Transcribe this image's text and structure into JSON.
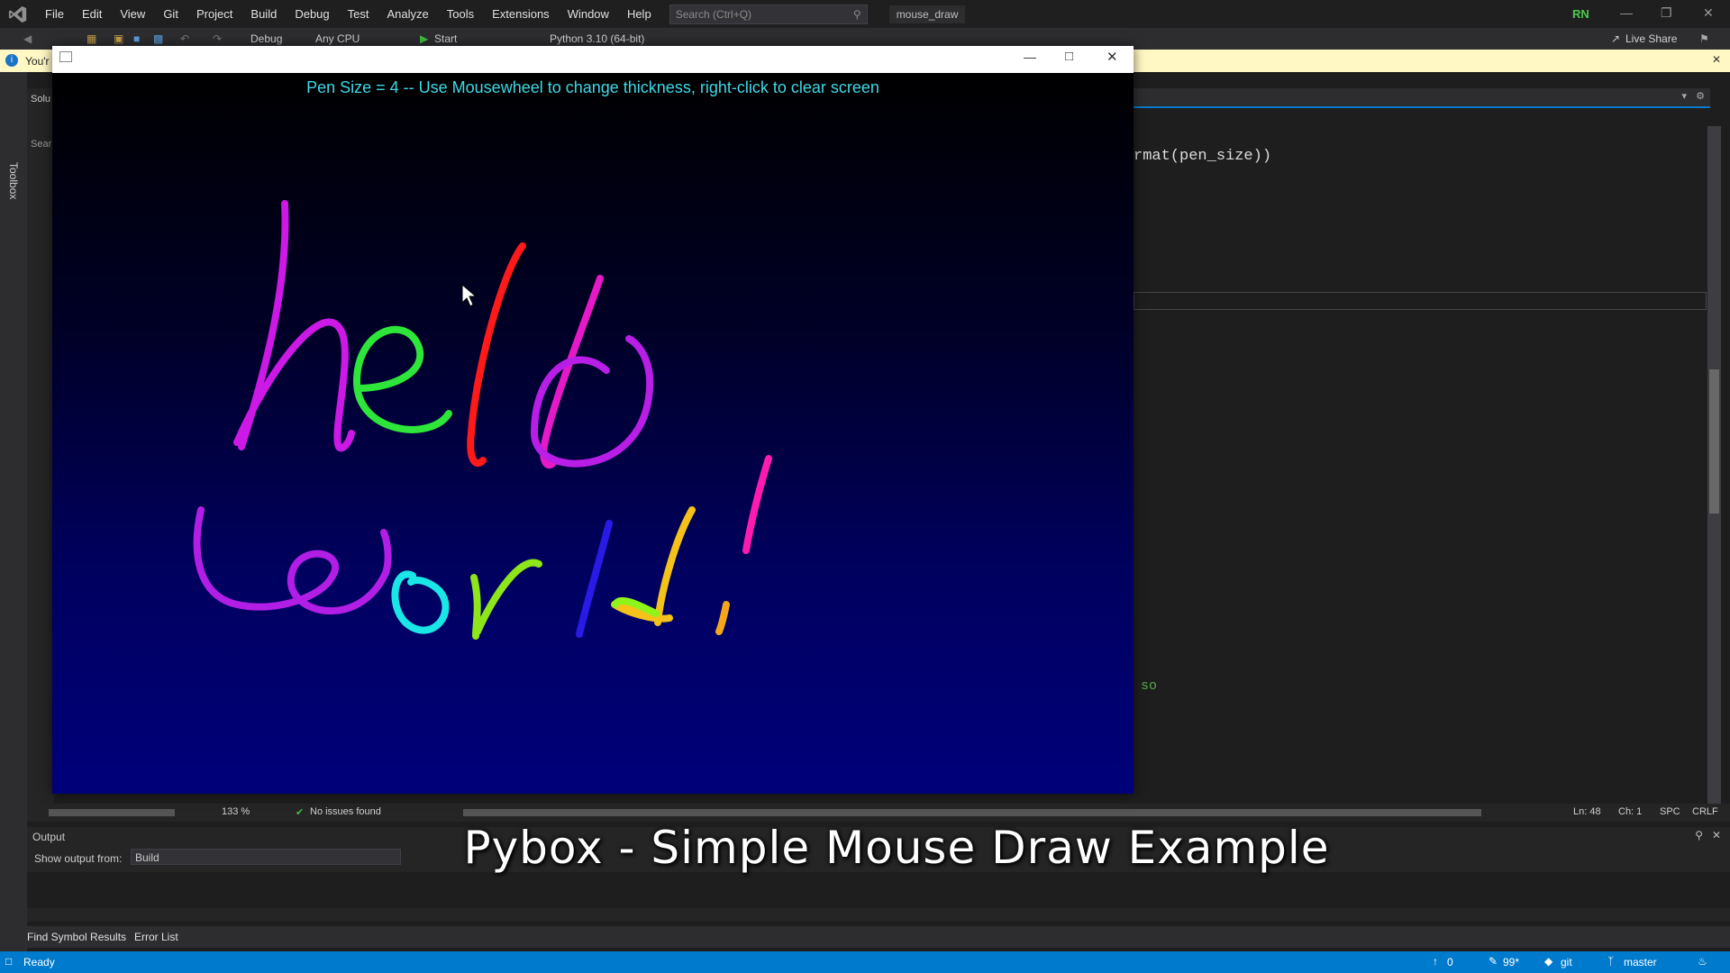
{
  "menubar": {
    "items": [
      "File",
      "Edit",
      "View",
      "Git",
      "Project",
      "Build",
      "Debug",
      "Test",
      "Analyze",
      "Tools",
      "Extensions",
      "Window",
      "Help"
    ],
    "search_placeholder": "Search (Ctrl+Q)",
    "solution_name": "mouse_draw",
    "user_initials": "RN"
  },
  "toolbar": {
    "config": "Debug",
    "platform": "Any CPU",
    "start_label": "Start",
    "environment": "Python 3.10 (64-bit)",
    "live_share": "Live Share"
  },
  "infobar": {
    "text": "You'r"
  },
  "toolbox": {
    "label": "Toolbox"
  },
  "solution_panel": {
    "label": "Solu",
    "search": "Sear"
  },
  "editor": {
    "line1": "rmat(pen_size))",
    "fragment": "so",
    "zoom": "133 %",
    "issues": "No issues found",
    "ln": "Ln: 48",
    "ch": "Ch: 1",
    "spc": "SPC",
    "eol": "CRLF"
  },
  "output": {
    "title": "Output",
    "show_from_label": "Show output from:",
    "source": "Build"
  },
  "bottom_tabs": [
    "Find Symbol Results",
    "Error List"
  ],
  "statusbar": {
    "ready": "Ready",
    "up_count": "0",
    "pencil_count": "99*",
    "git": "git",
    "branch": "master"
  },
  "pygame": {
    "pen_text": "Pen Size = 4 -- Use Mousewheel to change thickness, right-click to clear screen"
  },
  "caption": "Pybox - Simple Mouse Draw Example",
  "colors": {
    "accent": "#007acc",
    "pen_text": "#3fd8e6"
  }
}
